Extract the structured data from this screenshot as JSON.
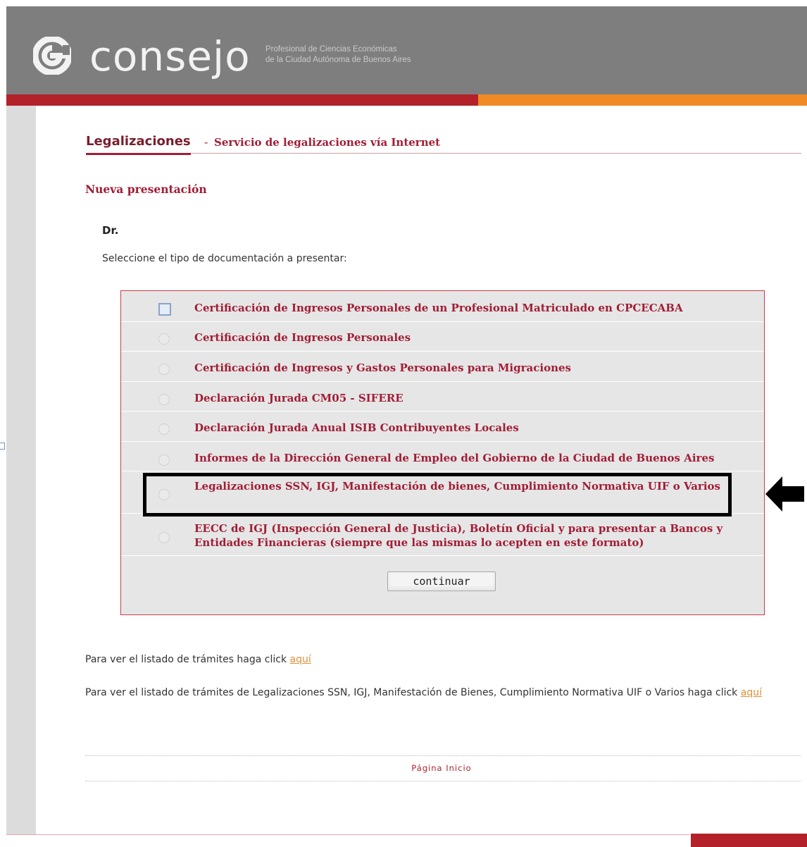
{
  "header": {
    "logo_word": "consejo",
    "logo_subtitle_line1": "Profesional de Ciencias Económicas",
    "logo_subtitle_line2": "de la Ciudad Autónoma de Buenos Aires",
    "brand_red": "#b3222b",
    "brand_orange": "#f08a24",
    "header_gray": "#7e7e7e"
  },
  "page": {
    "title": "Legalizaciones",
    "title_separator": "-",
    "subtitle": "Servicio de legalizaciones vía Internet",
    "section_title": "Nueva presentación",
    "doctor_label": "Dr.",
    "instruction": "Seleccione el tipo de documentación a presentar:"
  },
  "options": [
    {
      "label": "Certificación de Ingresos Personales de un Profesional Matriculado en CPCECABA",
      "control": "checkbox",
      "checked": false
    },
    {
      "label": "Certificación de Ingresos Personales",
      "control": "radio",
      "checked": false
    },
    {
      "label": "Certificación de Ingresos y Gastos Personales para Migraciones",
      "control": "radio",
      "checked": false
    },
    {
      "label": "Declaración Jurada CM05 - SIFERE",
      "control": "radio",
      "checked": false
    },
    {
      "label": "Declaración Jurada Anual ISIB Contribuyentes Locales",
      "control": "radio",
      "checked": false
    },
    {
      "label": "Informes de la Dirección General de Empleo del Gobierno de la Ciudad de Buenos Aires",
      "control": "radio",
      "checked": false
    },
    {
      "label": "Legalizaciones SSN, IGJ, Manifestación de bienes, Cumplimiento Normativa UIF o Varios",
      "control": "radio",
      "checked": false,
      "highlighted": true
    },
    {
      "label": "EECC de IGJ (Inspección General de Justicia), Boletín Oficial y para presentar a Bancos y Entidades Financieras (siempre que las mismas lo acepten en este formato)",
      "control": "radio",
      "checked": false
    }
  ],
  "continue_label": "continuar",
  "links": {
    "line1_text": "Para ver el listado de trámites haga click ",
    "line1_link": "aquí",
    "line2_text": "Para ver el listado de trámites de Legalizaciones SSN, IGJ, Manifestación de Bienes, Cumplimiento Normativa UIF o Varios haga click ",
    "line2_link": "aquí"
  },
  "footer": {
    "home_link": "Página Inicio"
  },
  "annotation": {
    "arrow_icon": "left-pointing-arrow-icon",
    "highlight_color": "#000000"
  }
}
